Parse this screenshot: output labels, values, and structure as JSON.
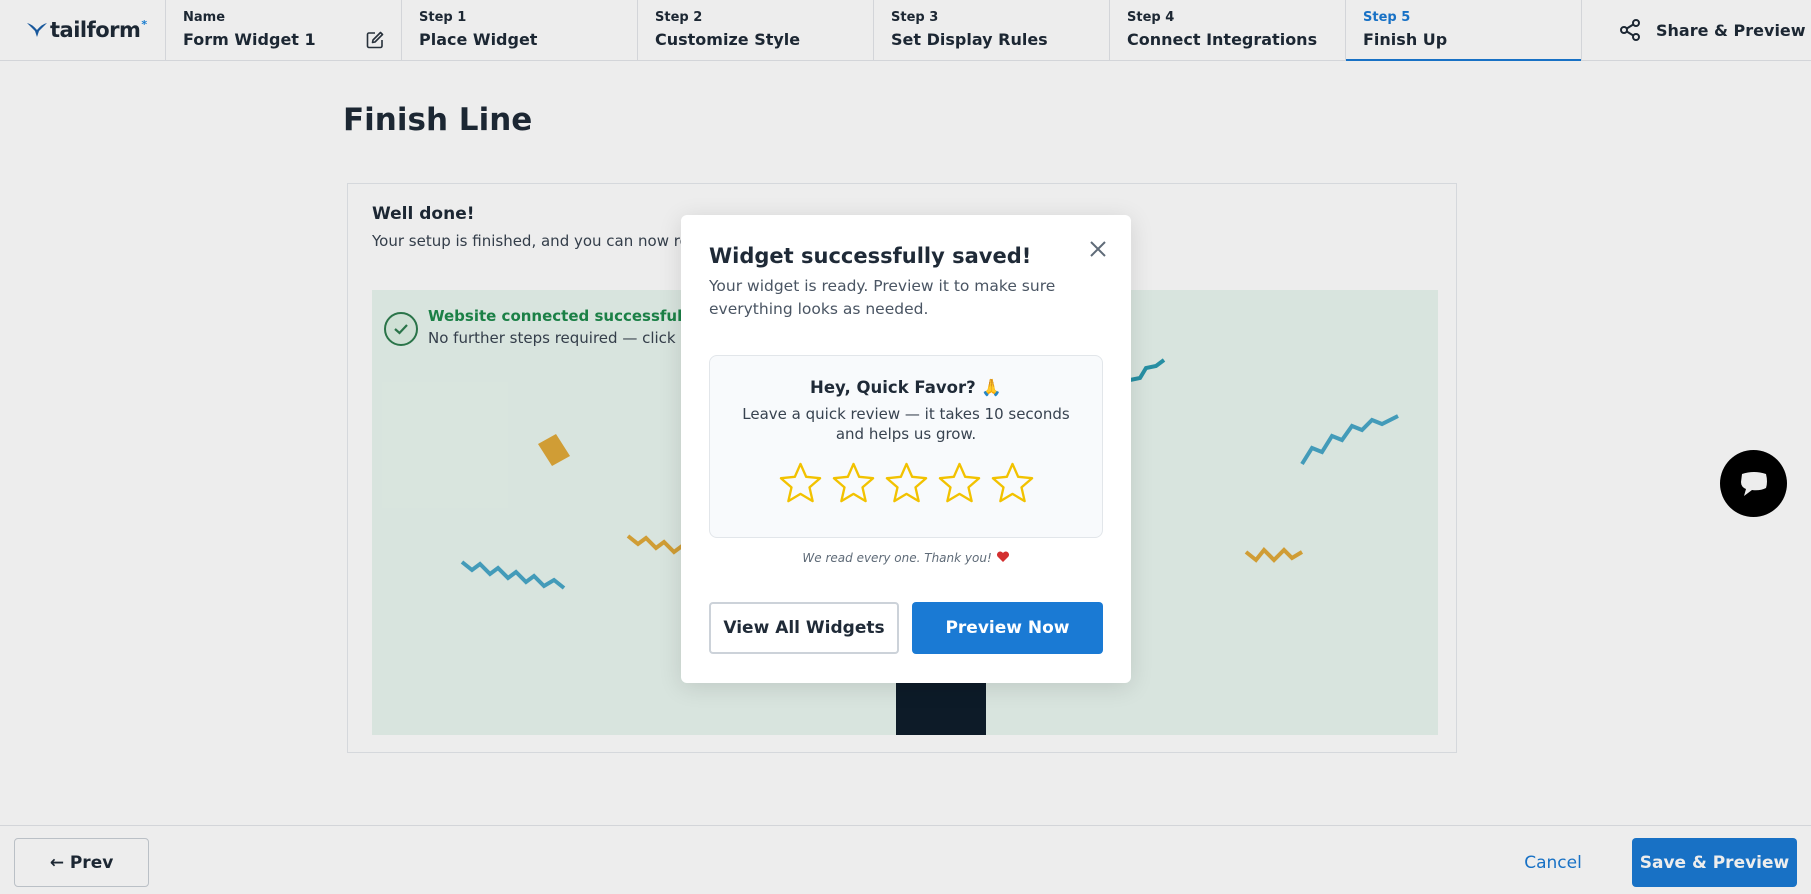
{
  "brand": {
    "logo_text": "tailform",
    "logo_dot": "*"
  },
  "header": {
    "name_caption": "Name",
    "name_value": "Form Widget 1",
    "steps": [
      {
        "caption": "Step 1",
        "label": "Place Widget",
        "active": false
      },
      {
        "caption": "Step 2",
        "label": "Customize Style",
        "active": false
      },
      {
        "caption": "Step 3",
        "label": "Set Display Rules",
        "active": false
      },
      {
        "caption": "Step 4",
        "label": "Connect Integrations",
        "active": false
      },
      {
        "caption": "Step 5",
        "label": "Finish Up",
        "active": true
      }
    ],
    "share_label": "Share & Preview"
  },
  "page": {
    "title": "Finish Line",
    "well_title": "Well done!",
    "well_sub": "Your setup is finished, and you can now re",
    "connected_title": "Website connected successfully",
    "connected_sub": "No further steps required — click s"
  },
  "footer": {
    "prev_label": "← Prev",
    "cancel_label": "Cancel",
    "save_label": "Save & Preview"
  },
  "modal": {
    "title": "Widget successfully saved!",
    "subtitle": "Your widget is ready. Preview it to make sure everything looks as needed.",
    "review_title": "Hey, Quick Favor? 🙏",
    "review_text": "Leave a quick review — it takes 10 seconds and helps us grow.",
    "star_count": 5,
    "thanks": "We read every one. Thank you!",
    "view_all_label": "View All Widgets",
    "preview_label": "Preview Now"
  },
  "colors": {
    "accent": "#1a7ad4",
    "success": "#1e8a4c",
    "star": "#f2c200",
    "panel": "#e9f6ef"
  }
}
